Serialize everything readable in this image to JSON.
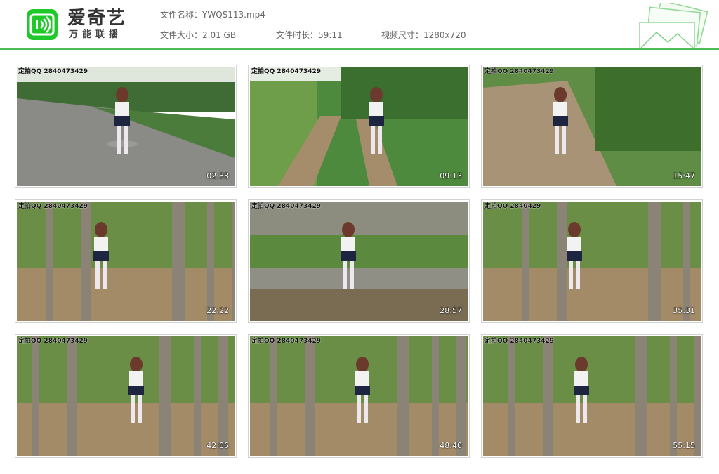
{
  "brand": {
    "name": "爱奇艺",
    "slogan": "万能联播",
    "accent_color": "#20c92a",
    "line_color": "#4fbd55"
  },
  "file_info": {
    "name_label": "文件名称：",
    "name_value": "YWQS113.mp4",
    "size_label": "文件大小：",
    "size_value": "2.01 GB",
    "duration_label": "文件时长：",
    "duration_value": "59:11",
    "resolution_label": "视频尺寸：",
    "resolution_value": "1280x720"
  },
  "thumbnails": [
    {
      "watermark": "定拍QQ 2840473429",
      "timestamp": "02:38",
      "scene": "road"
    },
    {
      "watermark": "定拍QQ 2840473429",
      "timestamp": "09:13",
      "scene": "path"
    },
    {
      "watermark": "定拍QQ 2840473429",
      "timestamp": "15:47",
      "scene": "field"
    },
    {
      "watermark": "定拍QQ 2840473429",
      "timestamp": "22:22",
      "scene": "trees"
    },
    {
      "watermark": "定拍QQ 2840473429",
      "timestamp": "28:57",
      "scene": "wall"
    },
    {
      "watermark": "定拍QQ 2840429",
      "timestamp": "35:31",
      "scene": "trees"
    },
    {
      "watermark": "定拍QQ 2840473429",
      "timestamp": "42:06",
      "scene": "trees"
    },
    {
      "watermark": "定拍QQ 2840473429",
      "timestamp": "48:40",
      "scene": "trees"
    },
    {
      "watermark": "定拍QQ 2840473429",
      "timestamp": "55:15",
      "scene": "trees"
    }
  ]
}
